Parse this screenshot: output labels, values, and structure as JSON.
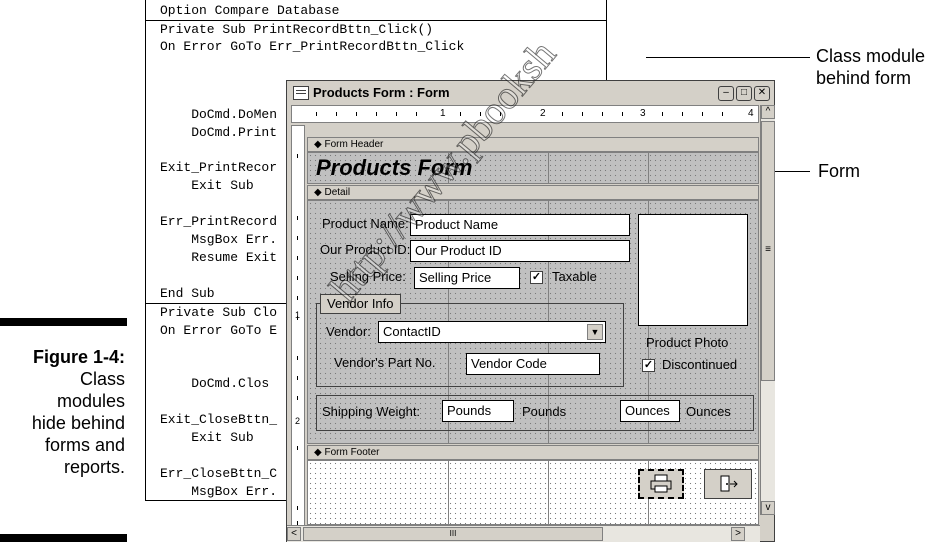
{
  "caption": {
    "label": "Figure 1-4:",
    "lines": [
      "Class",
      "modules",
      "hide behind",
      "forms and",
      "reports."
    ]
  },
  "code_window": {
    "lines": [
      "Option Compare Database",
      "Private Sub PrintRecordBttn_Click()",
      "On Error GoTo Err_PrintRecordBttn_Click",
      "    DoCmd.DoMen",
      "    DoCmd.Print",
      "Exit_PrintRecor",
      "    Exit Sub",
      "Err_PrintRecord",
      "    MsgBox Err.",
      "    Resume Exit",
      "End Sub",
      "Private Sub Clo",
      "On Error GoTo E",
      "    DoCmd.Clos",
      "Exit_CloseBttn_",
      "    Exit Sub",
      "Err_CloseBttn_C",
      "    MsgBox Err."
    ]
  },
  "annotations": {
    "class_module": [
      "Class module",
      "behind form"
    ],
    "form": "Form"
  },
  "watermark": "http://www.pbooksh",
  "form_window": {
    "title": "Products Form : Form",
    "controls": {
      "minimize": "–",
      "maximize": "□",
      "close": "✕"
    },
    "ruler_numbers": [
      "1",
      "2",
      "3",
      "4"
    ],
    "vruler_numbers": [
      "1",
      "2"
    ],
    "sections": {
      "header": "Form Header",
      "detail": "Detail",
      "footer": "Form Footer"
    },
    "form_title": "Products Form",
    "fields": {
      "product_name_label": "Product Name:",
      "product_name": "Product Name",
      "product_id_label": "Our Product ID:",
      "product_id": "Our Product ID",
      "selling_price_label": "Selling Price:",
      "selling_price": "Selling Price",
      "taxable": "Taxable",
      "vendor_info": "Vendor Info",
      "vendor_label": "Vendor:",
      "vendor": "ContactID",
      "vendor_part_label": "Vendor's Part No.",
      "vendor_code": "Vendor Code",
      "product_photo": "Product Photo",
      "discontinued": "Discontinued",
      "shipping_label": "Shipping Weight:",
      "pounds_field": "Pounds",
      "pounds_label": "Pounds",
      "ounces_field": "Ounces",
      "ounces_label": "Ounces"
    },
    "scroll": {
      "left": "<",
      "right": ">",
      "up": "^",
      "down": "v",
      "hthumb": "III",
      "vthumb": "≡"
    }
  }
}
